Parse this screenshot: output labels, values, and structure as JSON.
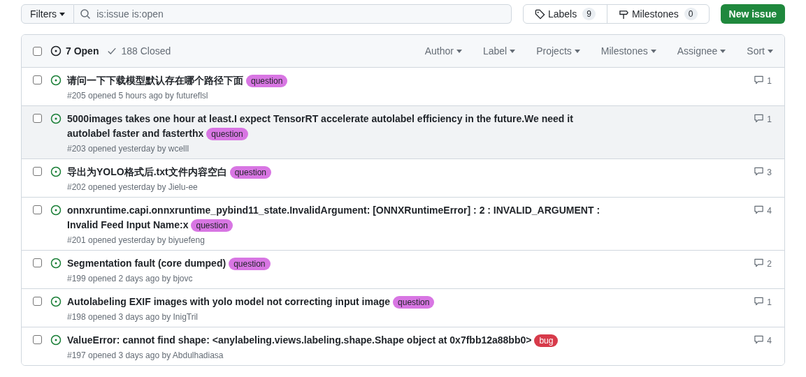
{
  "toolbar": {
    "filter_button": "Filters",
    "search": {
      "value": "is:issue is:open"
    },
    "labels": {
      "label": "Labels",
      "count": "9"
    },
    "milestones": {
      "label": "Milestones",
      "count": "0"
    },
    "new_button": "New issue"
  },
  "header": {
    "checked": false,
    "open": {
      "label": "7 Open",
      "selected": true
    },
    "closed": {
      "label": "188 Closed",
      "selected": false
    },
    "filters": [
      "Author",
      "Label",
      "Projects",
      "Milestones",
      "Assignee",
      "Sort"
    ]
  },
  "issues": [
    {
      "title_lines": [
        "请问一下下载模型默认存在哪个路径下面"
      ],
      "labels": [
        {
          "name": "question",
          "color": "#d876e3"
        }
      ],
      "meta": "#205 opened 5 hours ago by futureflsl",
      "comments": "1",
      "checked": false,
      "hovered": false
    },
    {
      "title_lines": [
        "5000images takes one hour at least.I expect TensorRT accelerate autolabel efficiency in the future.We need it",
        "autolabel faster and fasterthx"
      ],
      "labels": [
        {
          "name": "question",
          "color": "#d876e3"
        }
      ],
      "meta": "#203 opened yesterday by wcelll",
      "comments": "1",
      "checked": false,
      "hovered": true
    },
    {
      "title_lines": [
        "导出为YOLO格式后.txt文件内容空白"
      ],
      "labels": [
        {
          "name": "question",
          "color": "#d876e3"
        }
      ],
      "meta": "#202 opened yesterday by Jielu-ee",
      "comments": "3",
      "checked": false,
      "hovered": false
    },
    {
      "title_lines": [
        "onnxruntime.capi.onnxruntime_pybind11_state.InvalidArgument: [ONNXRuntimeError] : 2 : INVALID_ARGUMENT :",
        "Invalid Feed Input Name:x"
      ],
      "labels": [
        {
          "name": "question",
          "color": "#d876e3"
        }
      ],
      "meta": "#201 opened yesterday by biyuefeng",
      "comments": "4",
      "checked": false,
      "hovered": false
    },
    {
      "title_lines": [
        "Segmentation fault (core dumped)"
      ],
      "labels": [
        {
          "name": "question",
          "color": "#d876e3"
        }
      ],
      "meta": "#199 opened 2 days ago by bjovc",
      "comments": "2",
      "checked": false,
      "hovered": false
    },
    {
      "title_lines": [
        "Autolabeling EXIF images with yolo model not correcting input image"
      ],
      "labels": [
        {
          "name": "question",
          "color": "#d876e3"
        }
      ],
      "meta": "#198 opened 3 days ago by InigTril",
      "comments": "1",
      "checked": false,
      "hovered": false
    },
    {
      "title_lines": [
        "ValueError: cannot find shape: <anylabeling.views.labeling.shape.Shape object at 0x7fbb12a88bb0>"
      ],
      "labels": [
        {
          "name": "bug",
          "color": "#d73a4a"
        }
      ],
      "meta": "#197 opened 3 days ago by Abdulhadiasa",
      "comments": "4",
      "checked": false,
      "hovered": false
    }
  ]
}
